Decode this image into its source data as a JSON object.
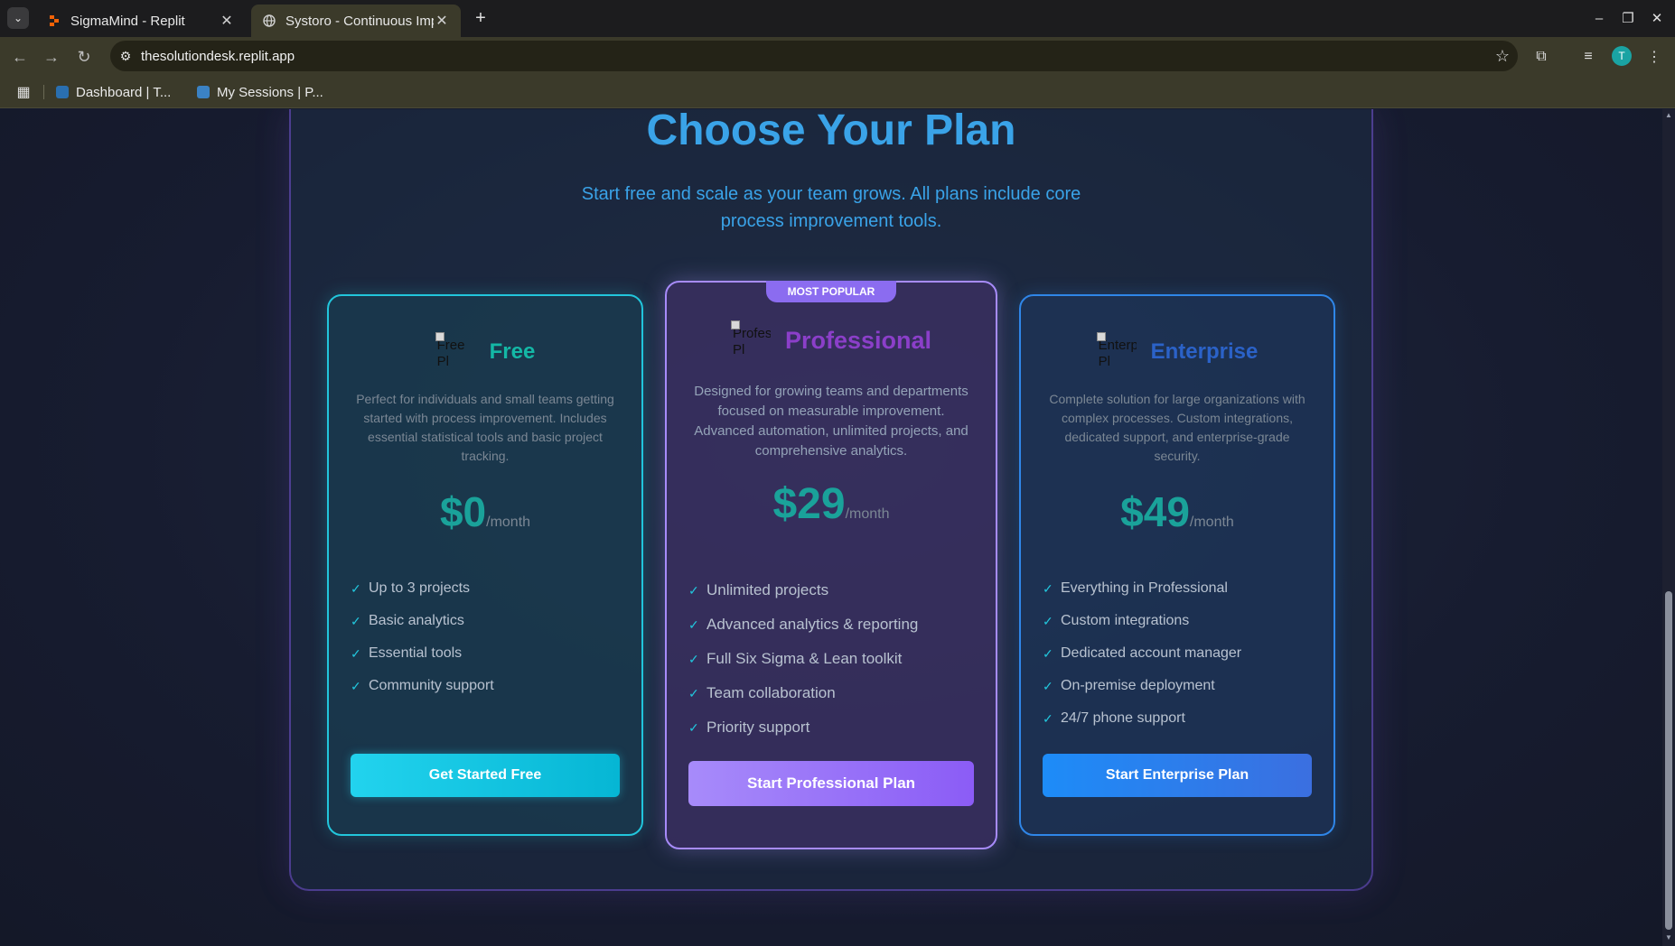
{
  "browser": {
    "tabs": [
      {
        "title": "SigmaMind - Replit",
        "icon": "replit-icon",
        "active": false
      },
      {
        "title": "Systoro - Continuous Imp",
        "icon": "globe-icon",
        "active": true
      }
    ],
    "url": "thesolutiondesk.replit.app",
    "profile_initial": "T",
    "bookmarks": [
      {
        "label": "Dashboard | T...",
        "color": "#2a6fb0"
      },
      {
        "label": "My Sessions | P...",
        "color": "#3b82c4"
      }
    ]
  },
  "page": {
    "heading": "Choose Your Plan",
    "subheading": "Start free and scale as your team grows. All plans include core process improvement tools.",
    "badge": "MOST POPULAR",
    "plans": [
      {
        "name": "Free",
        "img_alt": "Free Pl",
        "description": "Perfect for individuals and small teams getting started with process improvement. Includes essential statistical tools and basic project tracking.",
        "price": "$0",
        "period": "/month",
        "features": [
          "Up to 3 projects",
          "Basic analytics",
          "Essential tools",
          "Community support"
        ],
        "cta": "Get Started Free"
      },
      {
        "name": "Professional",
        "img_alt": "Profes Pl",
        "description": "Designed for growing teams and departments focused on measurable improvement. Advanced automation, unlimited projects, and comprehensive analytics.",
        "price": "$29",
        "period": "/month",
        "features": [
          "Unlimited projects",
          "Advanced analytics & reporting",
          "Full Six Sigma & Lean toolkit",
          "Team collaboration",
          "Priority support"
        ],
        "cta": "Start Professional Plan"
      },
      {
        "name": "Enterprise",
        "img_alt": "Enterp Pl",
        "description": "Complete solution for large organizations with complex processes. Custom integrations, dedicated support, and enterprise-grade security.",
        "price": "$49",
        "period": "/month",
        "features": [
          "Everything in Professional",
          "Custom integrations",
          "Dedicated account manager",
          "On-premise deployment",
          "24/7 phone support"
        ],
        "cta": "Start Enterprise Plan"
      }
    ],
    "check_glyph": "✓"
  },
  "colors": {
    "accent_cyan": "#22c6dc",
    "accent_purple": "#a78bfa",
    "accent_blue": "#2f86e8",
    "heading": "#3aa3e8"
  }
}
